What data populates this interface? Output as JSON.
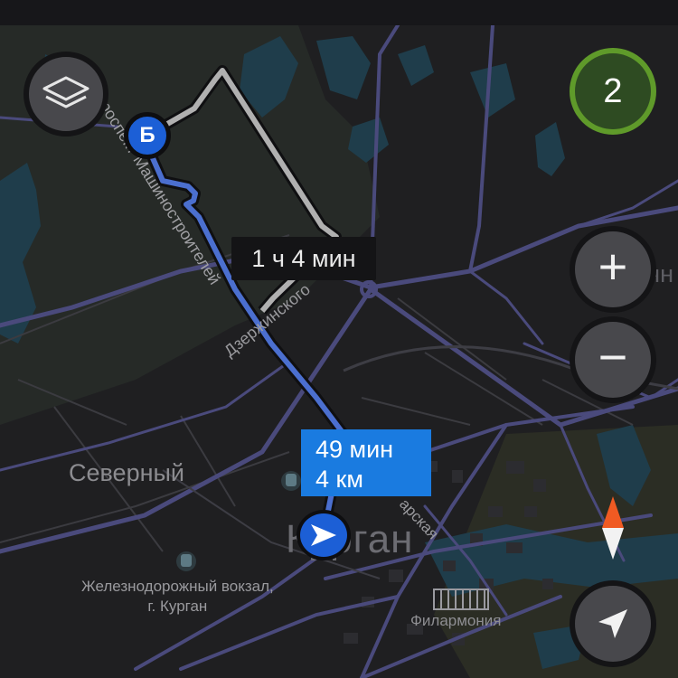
{
  "map": {
    "city_name": "Курган",
    "district_name": "Северный",
    "railway_station": {
      "line1": "Железнодорожный вокзал,",
      "line2": "г. Курган"
    },
    "poi_philharmonic": "Филармония",
    "partial_place": "Восточн",
    "streets": {
      "dzerzhinskogo": "Дзержинского",
      "mashinostroiteley": "проспект Машиностроителей",
      "bolshevistskaya": "арская"
    }
  },
  "route": {
    "main": {
      "time": "49 мин",
      "distance": "4 км"
    },
    "alternative": {
      "time": "1 ч 4 мин"
    },
    "destination_marker": "Б",
    "colors": {
      "main": "#1a7be0",
      "alternative": "#b0b0b0"
    }
  },
  "controls": {
    "traffic_level": "2",
    "zoom_in": "+",
    "zoom_out": "−",
    "layers_icon": "layers-icon",
    "compass_icon": "compass-icon",
    "locate_icon": "navigation-arrow-icon"
  },
  "colors": {
    "background": "#1f1f21",
    "water": "#1f3d4b",
    "roads": "#4a4a7c",
    "traffic_badge": "#5f9a2a"
  }
}
